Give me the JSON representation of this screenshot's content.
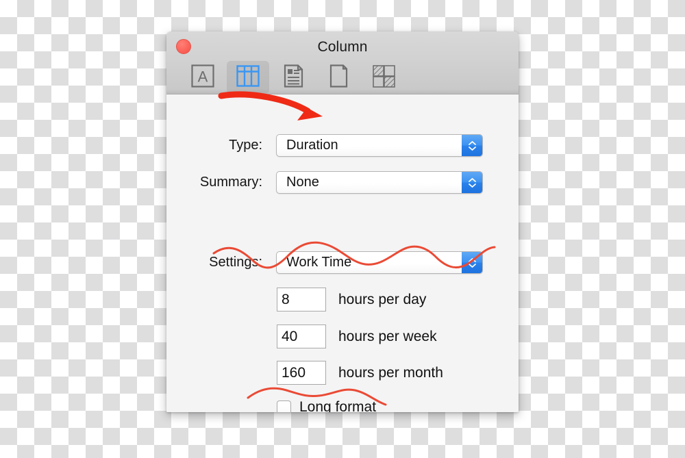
{
  "window": {
    "title": "Column",
    "close_button": "close",
    "toolbar": [
      {
        "name": "text-inspector",
        "icon": "letter-a-box-icon",
        "selected": false
      },
      {
        "name": "column-inspector",
        "icon": "table-columns-icon",
        "selected": true
      },
      {
        "name": "document-inspector",
        "icon": "document-text-icon",
        "selected": false
      },
      {
        "name": "page-inspector",
        "icon": "blank-page-icon",
        "selected": false
      },
      {
        "name": "pattern-inspector",
        "icon": "checker-squares-icon",
        "selected": false
      }
    ]
  },
  "form": {
    "type": {
      "label": "Type:",
      "value": "Duration"
    },
    "summary": {
      "label": "Summary:",
      "value": "None"
    },
    "settings": {
      "label": "Settings:",
      "value": "Work Time"
    },
    "hours": [
      {
        "value": "8",
        "unit": "hours per day"
      },
      {
        "value": "40",
        "unit": "hours per week"
      },
      {
        "value": "160",
        "unit": "hours per month"
      }
    ],
    "long_format": {
      "label": "Long format",
      "checked": false
    }
  },
  "annotations": {
    "arrow": {
      "name": "red-curved-arrow",
      "color": "#ef2b16"
    },
    "squiggle_top": {
      "name": "red-squiggle-underline-settings",
      "color": "#ea4a35"
    },
    "squiggle_bottom": {
      "name": "red-squiggle-underline-long-format",
      "color": "#ea4a35"
    }
  },
  "colors": {
    "accent_blue": "#2b82ea",
    "annotation_red": "#ef2b16",
    "window_bg": "#f4f4f4",
    "titlebar_bg": "#d2d2d2",
    "icon_gray": "#6e6e6e",
    "close_red": "#fc6258"
  }
}
